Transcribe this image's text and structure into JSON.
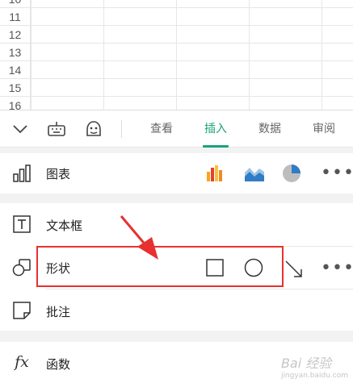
{
  "sheet": {
    "row_numbers": [
      "10",
      "11",
      "12",
      "13",
      "14",
      "15",
      "16"
    ]
  },
  "toolbar": {
    "tabs": [
      {
        "label": "查看",
        "active": false
      },
      {
        "label": "插入",
        "active": true
      },
      {
        "label": "数据",
        "active": false
      },
      {
        "label": "审阅",
        "active": false
      }
    ],
    "accent_color": "#1aa37a"
  },
  "insert_panel": {
    "chart": {
      "label": "图表"
    },
    "textbox": {
      "label": "文本框"
    },
    "shape": {
      "label": "形状"
    },
    "comment": {
      "label": "批注"
    },
    "function": {
      "label": "函数",
      "icon_text": "fx"
    }
  },
  "annotation": {
    "highlight_color": "#e83030"
  },
  "watermark": {
    "text": "Bai 经验",
    "sub": "jingyan.baidu.com"
  }
}
